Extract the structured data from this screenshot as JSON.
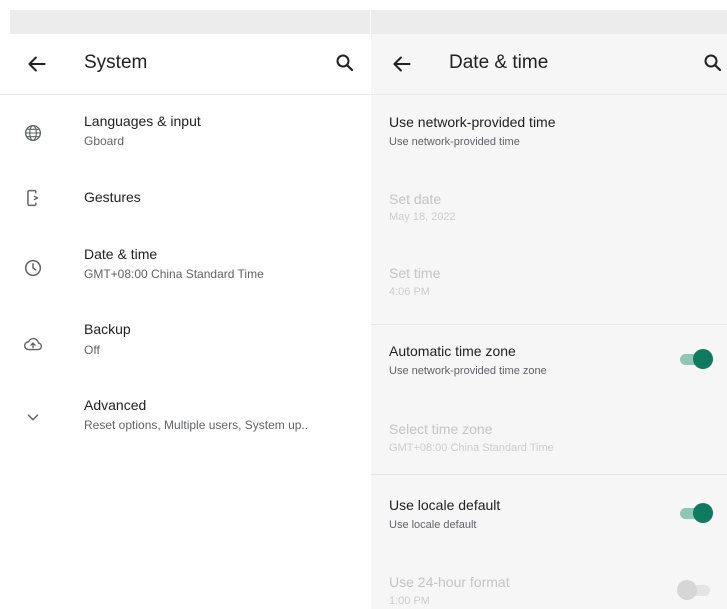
{
  "left_pane": {
    "title": "System",
    "items": [
      {
        "label": "Languages & input",
        "sub": "Gboard"
      },
      {
        "label": "Gestures",
        "sub": ""
      },
      {
        "label": "Date & time",
        "sub": "GMT+08:00 China Standard Time"
      },
      {
        "label": "Backup",
        "sub": "Off"
      },
      {
        "label": "Advanced",
        "sub": "Reset options, Multiple users, System up.."
      }
    ]
  },
  "right_pane": {
    "title": "Date & time",
    "prefs": [
      {
        "title": "Use network-provided time",
        "summary": "Use network-provided time",
        "enabled": true
      },
      {
        "title": "Set date",
        "summary": "May 18, 2022",
        "enabled": false
      },
      {
        "title": "Set time",
        "summary": "4:06 PM",
        "enabled": false
      },
      {
        "title": "Automatic time zone",
        "summary": "Use network-provided time zone",
        "enabled": true,
        "switch": "on"
      },
      {
        "title": "Select time zone",
        "summary": "GMT+08:00 China Standard Time",
        "enabled": false
      },
      {
        "title": "Use locale default",
        "summary": "Use locale default",
        "enabled": true,
        "switch": "on"
      },
      {
        "title": "Use 24-hour format",
        "summary": "1:00 PM",
        "enabled": false,
        "switch": "off"
      }
    ]
  },
  "icons": {
    "back": "arrow-back-icon",
    "search": "search-icon",
    "languages": "globe-icon",
    "gestures": "phone-gesture-icon",
    "date_time": "clock-icon",
    "backup": "cloud-upload-icon",
    "advanced": "chevron-down-icon"
  },
  "colors": {
    "accent": "#0f7a5f",
    "accent_track": "#8fc7b6",
    "detail_background": "#f6f6f6",
    "statusbar": "#ececec"
  }
}
